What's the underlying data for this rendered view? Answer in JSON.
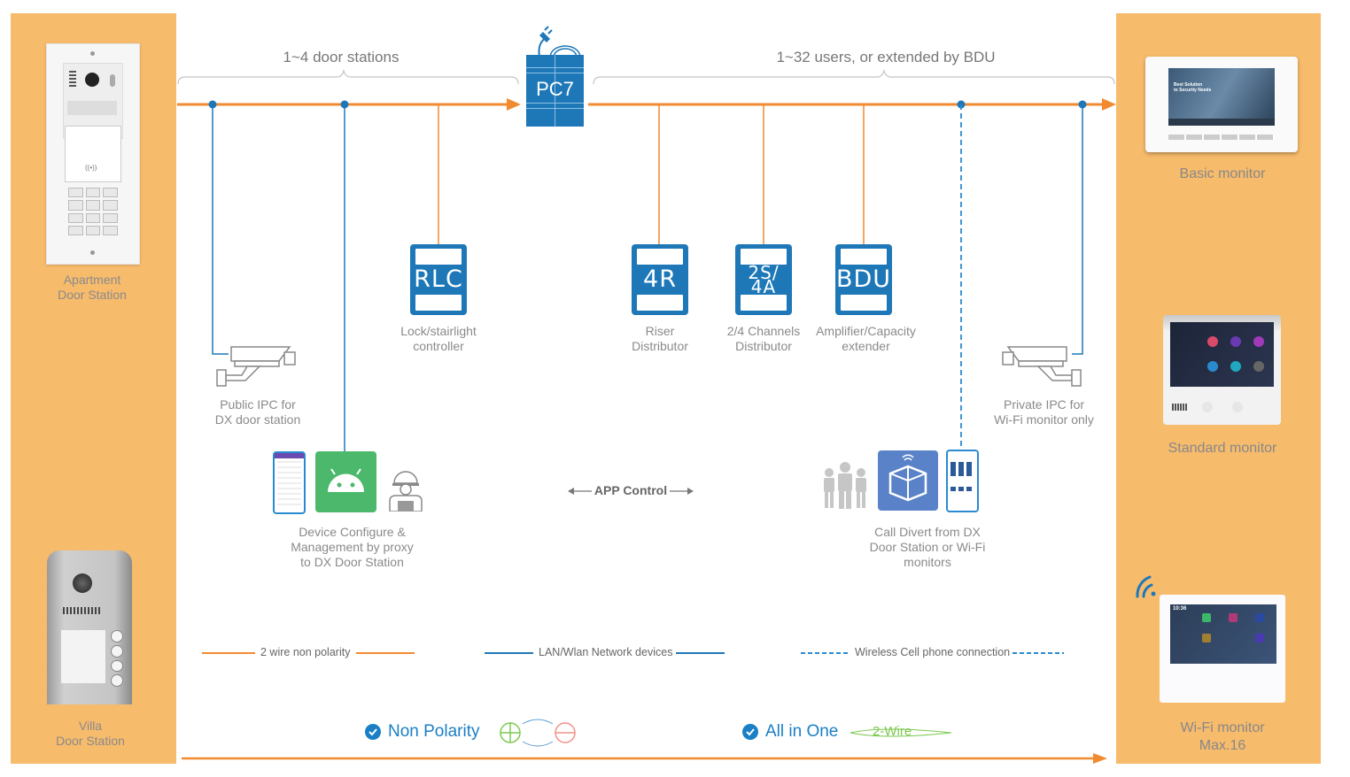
{
  "colors": {
    "panel": "#f7bb6c",
    "wire": "#f28a30",
    "network": "#1e78b8",
    "text": "#888888",
    "check": "#1a7fc4",
    "plus_green": "#7cc850",
    "minus_red": "#f09088"
  },
  "left_panel": {
    "apartment_label": "Apartment\nDoor Station",
    "villa_label": "Villa\nDoor Station"
  },
  "right_panel": {
    "basic_label": "Basic monitor",
    "basic_screen_text": "Best Solution\nto Security Needs",
    "standard_label": "Standard monitor",
    "wifi_label": "Wi-Fi monitor\nMax.16",
    "wifi_screen_time": "10:36"
  },
  "header": {
    "door_stations": "1~4 door stations",
    "users": "1~32 users, or extended by BDU",
    "hub": "PC7"
  },
  "modules": [
    {
      "code": "RLC",
      "label": "Lock/stairlight\ncontroller"
    },
    {
      "code": "4R",
      "label": "Riser\nDistributor"
    },
    {
      "code": "2S/\n4A",
      "label": "2/4 Channels\nDistributor"
    },
    {
      "code": "BDU",
      "label": "Amplifier/Capacity\nextender"
    }
  ],
  "cameras": {
    "public": "Public IPC for\nDX door station",
    "private": "Private IPC for\nWi-Fi monitor only"
  },
  "apps": {
    "config_label": "Device Configure &\nManagement by proxy\nto DX Door Station",
    "divert_label": "Call Divert from DX\nDoor Station or Wi-Fi\nmonitors",
    "app_control": "APP Control"
  },
  "legend": {
    "wire": "2 wire non polarity",
    "network": "LAN/Wlan Network devices",
    "wireless": "Wireless Cell phone connection"
  },
  "features": {
    "non_polarity": "Non Polarity",
    "all_in_one": "All in One",
    "two_wire": "2-Wire"
  }
}
